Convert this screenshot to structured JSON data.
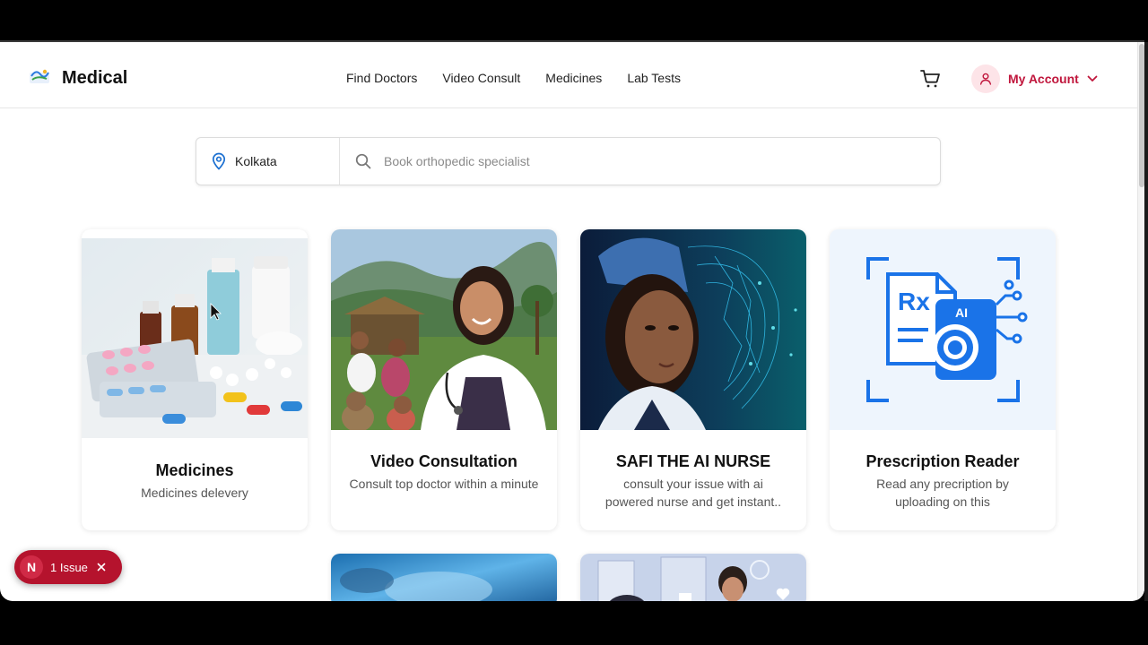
{
  "header": {
    "brand": "Medical",
    "nav": [
      "Find Doctors",
      "Video Consult",
      "Medicines",
      "Lab Tests"
    ],
    "account_label": "My Account"
  },
  "search": {
    "location": "Kolkata",
    "placeholder": "Book orthopedic specialist"
  },
  "cards": [
    {
      "title": "Medicines",
      "desc": "Medicines delevery"
    },
    {
      "title": "Video Consultation",
      "desc": "Consult top doctor within a minute"
    },
    {
      "title": "SAFI THE AI NURSE",
      "desc": "consult your issue with ai powered nurse and get instant.."
    },
    {
      "title": "Prescription Reader",
      "desc": "Read any precription by uploading on this"
    }
  ],
  "prescription_badges": {
    "rx": "Rx",
    "ai": "AI"
  },
  "issue_badge": {
    "letter": "N",
    "text": "1 Issue"
  },
  "colors": {
    "accent": "#c0163c",
    "icon_blue": "#1a73e8",
    "issue_red": "#b5132d"
  }
}
